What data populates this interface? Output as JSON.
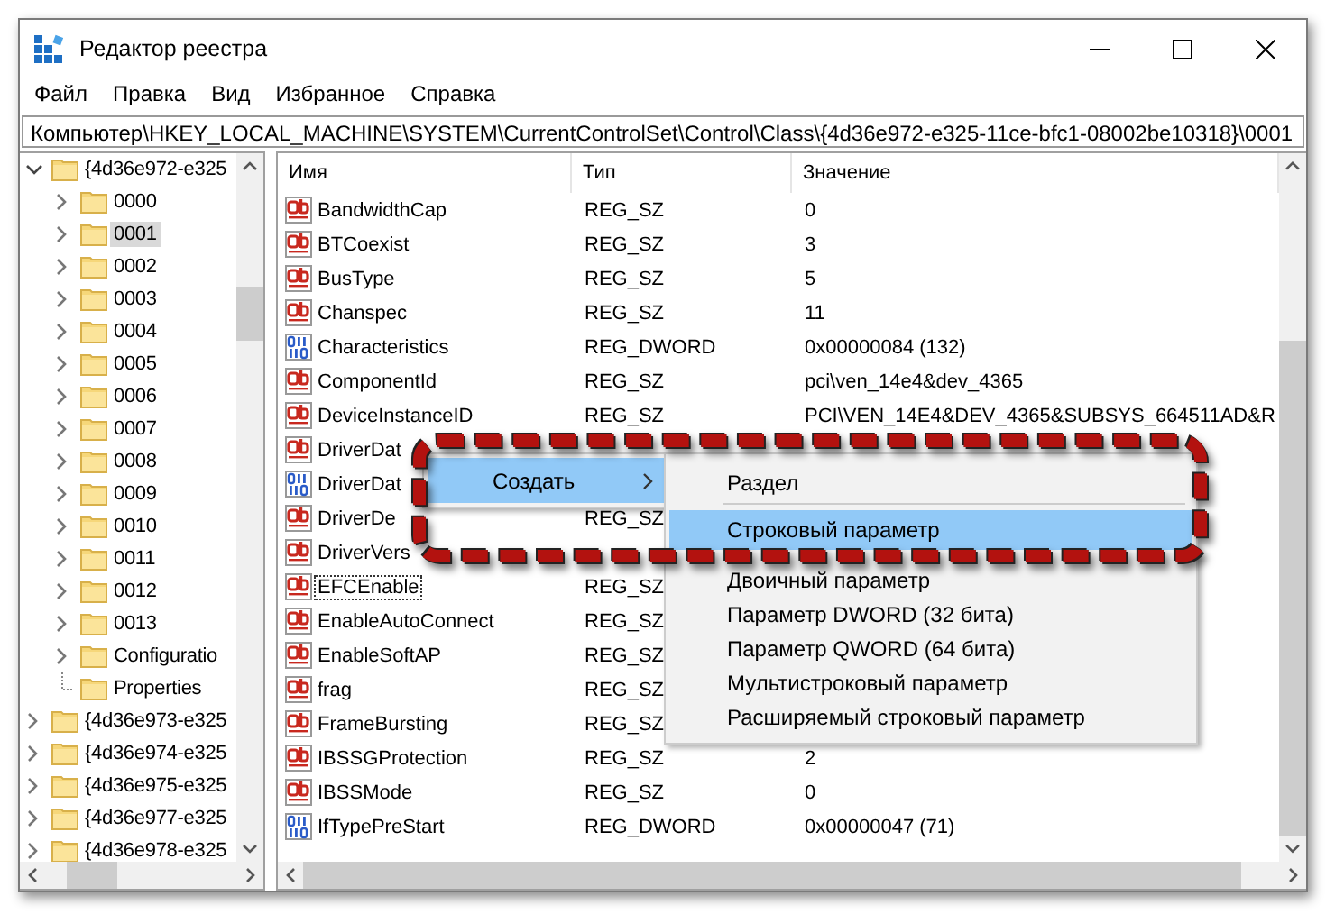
{
  "window": {
    "title": "Редактор реестра"
  },
  "menu_bar": [
    "Файл",
    "Правка",
    "Вид",
    "Избранное",
    "Справка"
  ],
  "address": "Компьютер\\HKEY_LOCAL_MACHINE\\SYSTEM\\CurrentControlSet\\Control\\Class\\{4d36e972-e325-11ce-bfc1-08002be10318}\\0001",
  "tree": [
    {
      "label": "{4d36e972-e325",
      "expanded": true,
      "selected": false,
      "children": [
        {
          "kind": "node",
          "label": "0000",
          "expanded": false,
          "selected": false
        },
        {
          "kind": "node",
          "label": "0001",
          "expanded": false,
          "selected": true
        },
        {
          "kind": "node",
          "label": "0002",
          "expanded": false,
          "selected": false
        },
        {
          "kind": "node",
          "label": "0003",
          "expanded": false,
          "selected": false
        },
        {
          "kind": "node",
          "label": "0004",
          "expanded": false,
          "selected": false
        },
        {
          "kind": "node",
          "label": "0005",
          "expanded": false,
          "selected": false
        },
        {
          "kind": "node",
          "label": "0006",
          "expanded": false,
          "selected": false
        },
        {
          "kind": "node",
          "label": "0007",
          "expanded": false,
          "selected": false
        },
        {
          "kind": "node",
          "label": "0008",
          "expanded": false,
          "selected": false
        },
        {
          "kind": "node",
          "label": "0009",
          "expanded": false,
          "selected": false
        },
        {
          "kind": "node",
          "label": "0010",
          "expanded": false,
          "selected": false
        },
        {
          "kind": "node",
          "label": "0011",
          "expanded": false,
          "selected": false
        },
        {
          "kind": "node",
          "label": "0012",
          "expanded": false,
          "selected": false
        },
        {
          "kind": "node",
          "label": "0013",
          "expanded": false,
          "selected": false
        },
        {
          "kind": "node",
          "label": "Configuratio",
          "expanded": false,
          "selected": false
        },
        {
          "kind": "leaf",
          "label": "Properties",
          "selected": false
        }
      ]
    },
    {
      "label": "{4d36e973-e325",
      "expanded": false,
      "selected": false
    },
    {
      "label": "{4d36e974-e325",
      "expanded": false,
      "selected": false
    },
    {
      "label": "{4d36e975-e325",
      "expanded": false,
      "selected": false
    },
    {
      "label": "{4d36e977-e325",
      "expanded": false,
      "selected": false
    },
    {
      "label": "{4d36e978-e325",
      "expanded": false,
      "selected": false
    }
  ],
  "list": {
    "columns": [
      "Имя",
      "Тип",
      "Значение"
    ],
    "rows": [
      {
        "kind": "string",
        "name": "BandwidthCap",
        "type": "REG_SZ",
        "value": "0",
        "focused": false
      },
      {
        "kind": "string",
        "name": "BTCoexist",
        "type": "REG_SZ",
        "value": "3",
        "focused": false
      },
      {
        "kind": "string",
        "name": "BusType",
        "type": "REG_SZ",
        "value": "5",
        "focused": false
      },
      {
        "kind": "string",
        "name": "Chanspec",
        "type": "REG_SZ",
        "value": "11",
        "focused": false
      },
      {
        "kind": "binary",
        "name": "Characteristics",
        "type": "REG_DWORD",
        "value": "0x00000084 (132)",
        "focused": false
      },
      {
        "kind": "string",
        "name": "ComponentId",
        "type": "REG_SZ",
        "value": "pci\\ven_14e4&dev_4365",
        "focused": false
      },
      {
        "kind": "string",
        "name": "DeviceInstanceID",
        "type": "REG_SZ",
        "value": "PCI\\VEN_14E4&DEV_4365&SUBSYS_664511AD&R",
        "focused": false
      },
      {
        "kind": "string",
        "name": "DriverDat",
        "focused": false
      },
      {
        "kind": "binary",
        "name": "DriverDat",
        "focused": false
      },
      {
        "kind": "string",
        "name": "DriverDe",
        "type": "REG_SZ",
        "focused": false
      },
      {
        "kind": "string",
        "name": "DriverVers",
        "focused": false
      },
      {
        "kind": "string",
        "name": "EFCEnable",
        "type": "REG_SZ",
        "focused": true
      },
      {
        "kind": "string",
        "name": "EnableAutoConnect",
        "type": "REG_SZ",
        "focused": false
      },
      {
        "kind": "string",
        "name": "EnableSoftAP",
        "type": "REG_SZ",
        "focused": false
      },
      {
        "kind": "string",
        "name": "frag",
        "type": "REG_SZ",
        "focused": false
      },
      {
        "kind": "string",
        "name": "FrameBursting",
        "type": "REG_SZ",
        "focused": false
      },
      {
        "kind": "string",
        "name": "IBSSGProtection",
        "type": "REG_SZ",
        "value": "2",
        "focused": false
      },
      {
        "kind": "string",
        "name": "IBSSMode",
        "type": "REG_SZ",
        "value": "0",
        "focused": false
      },
      {
        "kind": "binary",
        "name": "IfTypePreStart",
        "type": "REG_DWORD",
        "value": "0x00000047 (71)",
        "focused": false
      }
    ]
  },
  "context_menu": {
    "items": [
      {
        "label": "Создать",
        "selected": true,
        "has_submenu": true
      }
    ]
  },
  "submenu": {
    "items": [
      {
        "kind": "item",
        "label": "Раздел",
        "selected": false
      },
      {
        "kind": "separator"
      },
      {
        "kind": "item",
        "label": "Строковый параметр",
        "selected": true
      },
      {
        "kind": "item",
        "label": "Двоичный параметр",
        "selected": false
      },
      {
        "kind": "item",
        "label": "Параметр DWORD (32 бита)",
        "selected": false
      },
      {
        "kind": "item",
        "label": "Параметр QWORD (64 бита)",
        "selected": false
      },
      {
        "kind": "item",
        "label": "Мультистроковый параметр",
        "selected": false
      },
      {
        "kind": "item",
        "label": "Расширяемый строковый параметр",
        "selected": false
      }
    ]
  }
}
